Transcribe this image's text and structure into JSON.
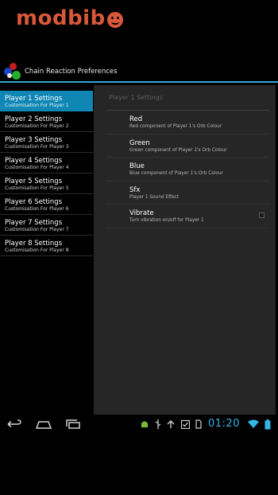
{
  "brand": {
    "text": "modbib",
    "logo": "smiley-o"
  },
  "actionbar": {
    "title": "Chain Reaction Preferences",
    "app_icon": "orbs-icon"
  },
  "headers": [
    {
      "title": "Player 1 Settings",
      "summary": "Customisation For Player 1",
      "active": true
    },
    {
      "title": "Player 2 Settings",
      "summary": "Customisation For Player 2",
      "active": false
    },
    {
      "title": "Player 3 Settings",
      "summary": "Customisation For Player 3",
      "active": false
    },
    {
      "title": "Player 4 Settings",
      "summary": "Customisation For Player 4",
      "active": false
    },
    {
      "title": "Player 5 Settings",
      "summary": "Customisation For Player 5",
      "active": false
    },
    {
      "title": "Player 6 Settings",
      "summary": "Customisation For Player 6",
      "active": false
    },
    {
      "title": "Player 7 Settings",
      "summary": "Customisation For Player 7",
      "active": false
    },
    {
      "title": "Player 8 Settings",
      "summary": "Customisation For Player 8",
      "active": false
    }
  ],
  "panel": {
    "category_title": "Player 1 Settings",
    "prefs": [
      {
        "title": "Red",
        "summary": "Red component of Player 1's Orb Colour"
      },
      {
        "title": "Green",
        "summary": "Green component of Player 1's Orb Colour"
      },
      {
        "title": "Blue",
        "summary": "Blue component of Player 1's Orb Colour"
      },
      {
        "title": "Sfx",
        "summary": "Player 1 Sound Effect"
      },
      {
        "title": "Vibrate",
        "summary": "Turn vibration on/off for Player 1",
        "checkbox": false
      }
    ]
  },
  "statusbar": {
    "time": "01:20",
    "icons": [
      "android-debug-icon",
      "usb-icon",
      "upload-icon",
      "download-done-icon",
      "sd-card-icon",
      "wifi-icon",
      "battery-icon"
    ]
  },
  "nav": {
    "back": "back-icon",
    "home": "home-icon",
    "recent": "recent-apps-icon"
  },
  "colors": {
    "accent": "#33b5e5",
    "selected": "#0f86b3",
    "brand": "#d9583a",
    "panel": "#262626"
  }
}
